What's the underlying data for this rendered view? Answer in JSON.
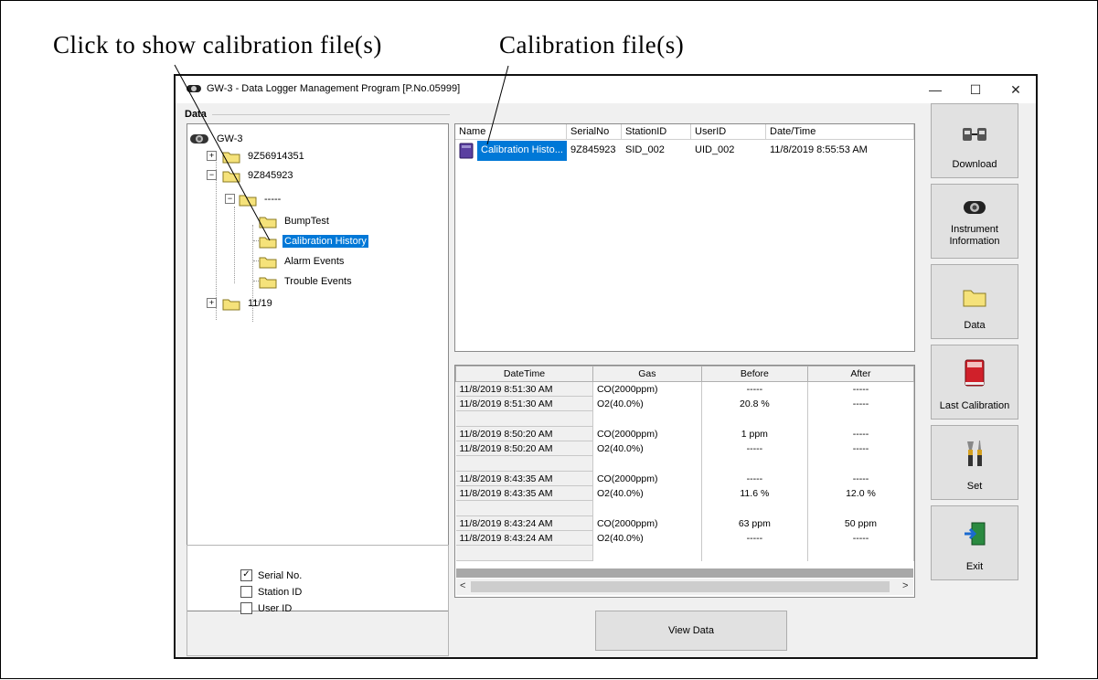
{
  "annotations": {
    "left_callout": "Click to show calibration file(s)",
    "right_callout": "Calibration file(s)"
  },
  "window": {
    "title": "GW-3 - Data Logger Management Program [P.No.05999]",
    "minimize": "—",
    "maximize": "☐",
    "close": "✕"
  },
  "data_panel": {
    "label": "Data",
    "tree": {
      "root": "GW-3",
      "node_1": "9Z56914351",
      "node_2": "9Z845923",
      "node_2_child": "-----",
      "bump_test": "BumpTest",
      "calibration_history": "Calibration History",
      "alarm_events": "Alarm Events",
      "trouble_events": "Trouble Events",
      "node_3": "11/19"
    }
  },
  "filters": {
    "serial_no": {
      "label": "Serial No.",
      "checked": "✓"
    },
    "station_id": {
      "label": "Station ID",
      "checked": ""
    },
    "user_id": {
      "label": "User ID",
      "checked": ""
    }
  },
  "file_list": {
    "columns": [
      "Name",
      "SerialNo",
      "StationID",
      "UserID",
      "Date/Time"
    ],
    "row": {
      "name": "Calibration Histo...",
      "serial": "9Z845923",
      "station": "SID_002",
      "user": "UID_002",
      "datetime": "11/8/2019 8:55:53 AM"
    }
  },
  "calibration_table": {
    "columns": [
      "DateTime",
      "Gas",
      "Before",
      "After"
    ],
    "rows": [
      [
        "11/8/2019 8:51:30 AM",
        "CO(2000ppm)",
        "-----",
        "-----"
      ],
      [
        "11/8/2019 8:51:30 AM",
        "O2(40.0%)",
        "20.8 %",
        "-----"
      ],
      [
        "",
        "",
        "",
        ""
      ],
      [
        "11/8/2019 8:50:20 AM",
        "CO(2000ppm)",
        "1 ppm",
        "-----"
      ],
      [
        "11/8/2019 8:50:20 AM",
        "O2(40.0%)",
        "-----",
        "-----"
      ],
      [
        "",
        "",
        "",
        ""
      ],
      [
        "11/8/2019 8:43:35 AM",
        "CO(2000ppm)",
        "-----",
        "-----"
      ],
      [
        "11/8/2019 8:43:35 AM",
        "O2(40.0%)",
        "11.6 %",
        "12.0 %"
      ],
      [
        "",
        "",
        "",
        ""
      ],
      [
        "11/8/2019 8:43:24 AM",
        "CO(2000ppm)",
        "63 ppm",
        "50 ppm"
      ],
      [
        "11/8/2019 8:43:24 AM",
        "O2(40.0%)",
        "-----",
        "-----"
      ],
      [
        "",
        "",
        "",
        ""
      ]
    ],
    "scroll_left": "<",
    "scroll_right": ">"
  },
  "view_data_label": "View Data",
  "side_buttons": {
    "download": "Download",
    "instrument_info_line1": "Instrument",
    "instrument_info_line2": "Information",
    "data": "Data",
    "last_calibration": "Last Calibration",
    "set": "Set",
    "exit": "Exit"
  },
  "colors": {
    "selection": "#0078d7",
    "folder": "#f5e27a",
    "window_bg": "#f0f0f0",
    "button_bg": "#e1e1e1"
  }
}
